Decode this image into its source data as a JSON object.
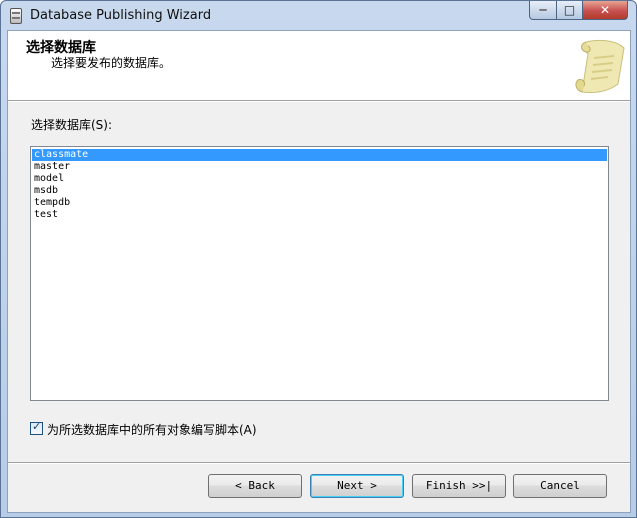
{
  "window": {
    "title": "Database Publishing Wizard",
    "controls": {
      "minimize": "─",
      "maximize": "□",
      "close": "✕"
    }
  },
  "header": {
    "title": "选择数据库",
    "subtitle": "选择要发布的数据库。",
    "graphic_icon": "scroll-icon"
  },
  "database_section": {
    "label": "选择数据库(S):",
    "items": [
      "classmate",
      "master",
      "model",
      "msdb",
      "tempdb",
      "test"
    ],
    "selected": "classmate"
  },
  "script_all_option": {
    "label": "为所选数据库中的所有对象编写脚本(A)",
    "checked": true
  },
  "buttons": {
    "back": "< Back",
    "next": "Next >",
    "finish": "Finish >>|",
    "cancel": "Cancel"
  },
  "colors": {
    "selection": "#3399ff",
    "title_bar": "#b9d1ea",
    "close_button": "#c75050"
  }
}
